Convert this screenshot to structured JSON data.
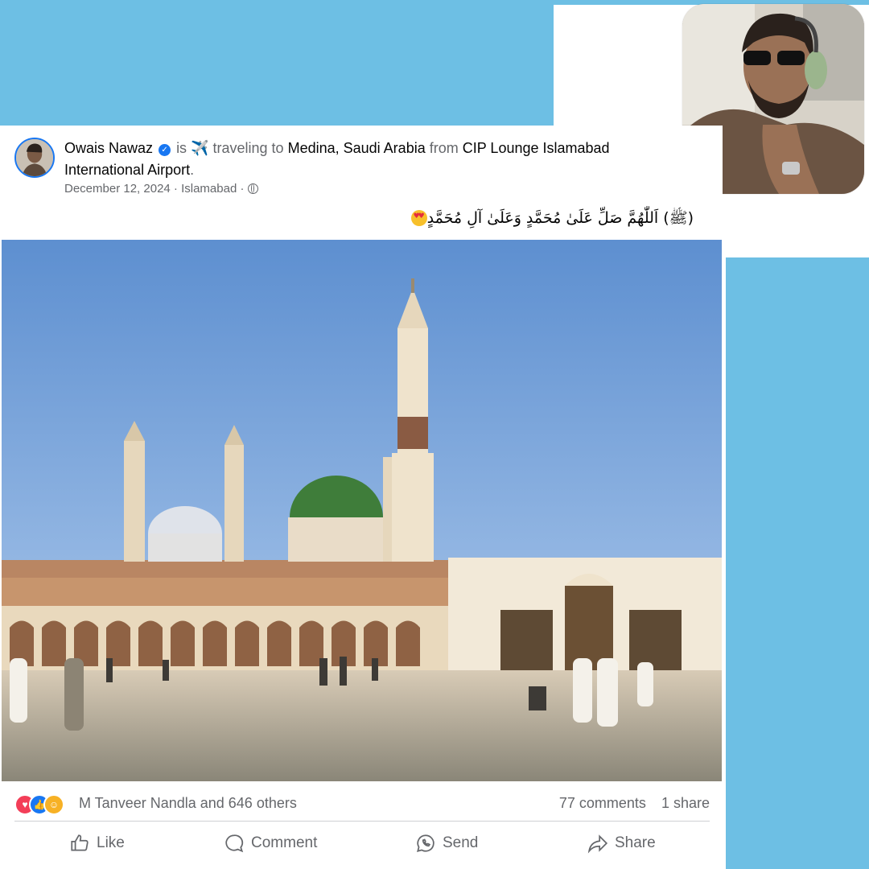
{
  "post": {
    "author": "Owais Nawaz",
    "activity_is": "is",
    "activity_emoji": "✈️",
    "activity_text": "traveling to",
    "destination": "Medina, Saudi Arabia",
    "from_word": "from",
    "origin": "CIP Lounge Islamabad International Airport",
    "end_punct": ".",
    "date": "December 12, 2024",
    "sep1": "·",
    "location": "Islamabad",
    "sep2": "·",
    "caption": "(ﷺ) اَللّٰهُمَّ صَلِّ عَلَىٰ مُحَمَّدٍ وَعَلَىٰ آلِ مُحَمَّدٍ"
  },
  "reactions": {
    "reactors": "M Tanveer Nandla and 646 others",
    "comments": "77 comments",
    "shares": "1 share",
    "icons": [
      "love-icon",
      "like-icon",
      "care-icon"
    ]
  },
  "actions": {
    "like": "Like",
    "comment": "Comment",
    "send": "Send",
    "share": "Share"
  },
  "colors": {
    "background_blue": "#6dbfe4",
    "brand_blue": "#1877f2",
    "secondary_text": "#65676b"
  }
}
